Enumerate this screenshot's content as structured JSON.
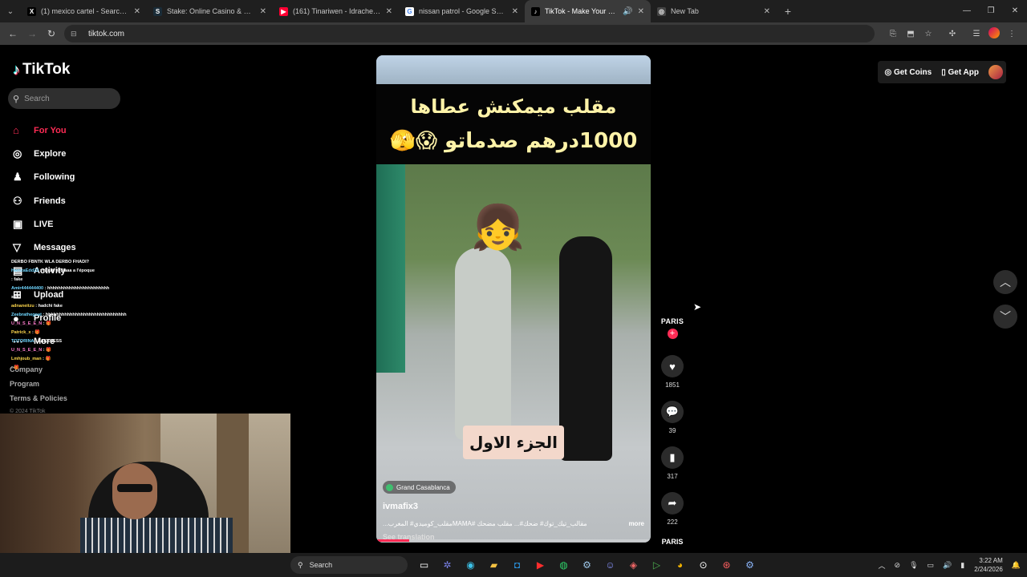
{
  "browser": {
    "tabs": [
      {
        "title": "(1) mexico cartel - Search / X",
        "icon": "x-logo",
        "icon_text": "X",
        "icon_color": "#000000"
      },
      {
        "title": "Stake: Online Casino & Sports B",
        "icon": "stake-logo",
        "icon_text": "S",
        "icon_color": "#1a2c38"
      },
      {
        "title": "(161) Tinariwen - Idrache (Trace",
        "icon": "youtube-logo",
        "icon_text": "▶",
        "icon_color": "#ff0033"
      },
      {
        "title": "nissan patrol - Google Search",
        "icon": "google-logo",
        "icon_text": "G",
        "icon_color": "#ffffff"
      },
      {
        "title": "TikTok - Make Your Day",
        "icon": "tiktok-logo",
        "icon_text": "♪",
        "icon_color": "#000000",
        "active": true
      },
      {
        "title": "New Tab",
        "icon": "chrome-logo",
        "icon_text": "◎",
        "icon_color": "#444444"
      }
    ],
    "url": "tiktok.com"
  },
  "tiktok": {
    "brand": "TikTok",
    "search_placeholder": "Search",
    "nav": [
      {
        "label": "For You",
        "icon": "home-icon",
        "glyph": "⌂"
      },
      {
        "label": "Explore",
        "icon": "compass-icon",
        "glyph": "◎"
      },
      {
        "label": "Following",
        "icon": "people-icon",
        "glyph": "♟"
      },
      {
        "label": "Friends",
        "icon": "friends-icon",
        "glyph": "⚇"
      },
      {
        "label": "LIVE",
        "icon": "live-icon",
        "glyph": "▣"
      },
      {
        "label": "Messages",
        "icon": "messages-icon",
        "glyph": "▽"
      },
      {
        "label": "Activity",
        "icon": "activity-icon",
        "glyph": "▤"
      },
      {
        "label": "Upload",
        "icon": "upload-icon",
        "glyph": "⊞"
      },
      {
        "label": "Profile",
        "icon": "profile-icon",
        "glyph": "●"
      },
      {
        "label": "More",
        "icon": "more-icon",
        "glyph": "···"
      }
    ],
    "footer": {
      "company": "Company",
      "program": "Program",
      "terms": "Terms & Policies",
      "copyright": "© 2024 TikTok"
    },
    "top_right": {
      "coins": "Get Coins",
      "app": "Get App"
    },
    "video": {
      "caption_line1": "مقلب ميمكنش عطاها",
      "caption_line2": "1000درهم صدماتو 😱🫣",
      "overlay_label": "الجزء الاول",
      "location": "Grand Casablanca",
      "username": "ivmafix3",
      "description": "...مقلب_كوميدي# المغربMAMA# مقالب_تيك_توك# ضحك#... مقلب مضحك",
      "more": "more",
      "see_translation": "See translation",
      "progress": 0.12
    },
    "actions": {
      "author": "PARIS",
      "likes": "1851",
      "comments": "39",
      "saves": "317",
      "shares": "222",
      "music": "PARIS"
    }
  },
  "chat": [
    {
      "user": "",
      "msg": "DERBO FBNTK WLA DERBO FHADI?"
    },
    {
      "user": "HamzaEdd23",
      "msg": ": wuuY ne3jaaa a l'époque"
    },
    {
      "user": "",
      "msg": ""
    },
    {
      "user": "",
      "msg": ": fake"
    },
    {
      "user": "Amir444444400",
      "msg": ": hhhhhhhhhhhhhhhhhhhhhhh"
    },
    {
      "user": "",
      "msg": "sari"
    },
    {
      "user": "adnaneitzu",
      "msg": ": hadchi fake"
    },
    {
      "user": "Zeebrathegoat",
      "msg": ": hhhhhhhhhhhhhhhhhhhhhhhhhhhhhh"
    },
    {
      "user": "U_N_S_E_E_N",
      "msg": ": 🎁"
    },
    {
      "user": "Patrick_x",
      "msg": ": 🎁"
    },
    {
      "user": "TOTORINA",
      "msg": ": FAKENESS"
    },
    {
      "user": "U_N_S_E_E_N",
      "msg": ": 🎁"
    },
    {
      "user": "Lmhjoub_man",
      "msg": ": 🎁"
    },
    {
      "user": "",
      "msg": ": 🎁"
    }
  ],
  "taskbar": {
    "search": "Search",
    "time": "3:22 AM",
    "date": "2/24/2026"
  }
}
